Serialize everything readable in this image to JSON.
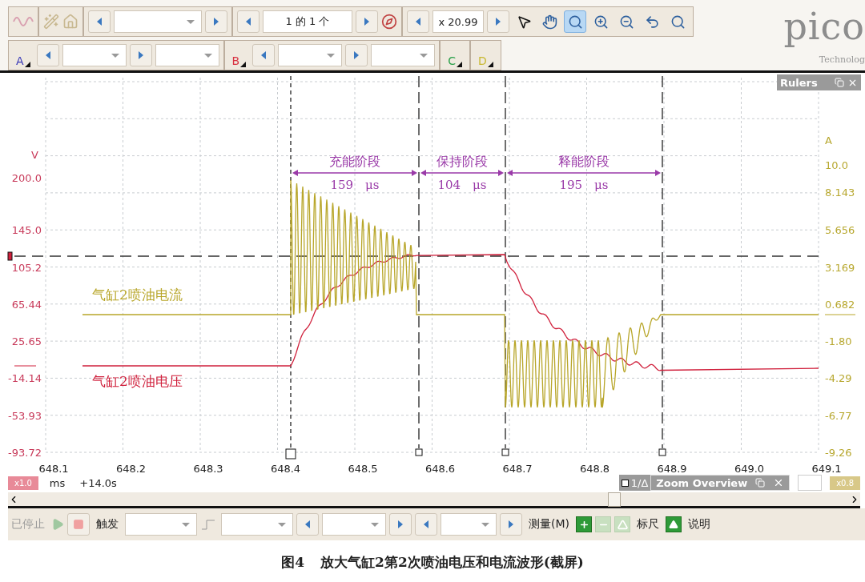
{
  "toolbar_top": {
    "page_field": "1 的 1 个",
    "zoom_field": "x 20.99",
    "tools": [
      {
        "kind": "pointer",
        "selected": false
      },
      {
        "kind": "hand",
        "selected": false
      },
      {
        "kind": "zoom",
        "selected": true
      },
      {
        "kind": "zoom_in",
        "selected": false
      },
      {
        "kind": "zoom_out",
        "selected": false
      },
      {
        "kind": "undo",
        "selected": false
      },
      {
        "kind": "zoom_100",
        "selected": false
      }
    ]
  },
  "channel_bar": {
    "channels": [
      {
        "label": "A",
        "color": "#3a3ab8"
      },
      {
        "label": "B",
        "color": "#d83040"
      },
      {
        "label": "C",
        "color": "#28a048"
      },
      {
        "label": "D",
        "color": "#c8b830"
      }
    ]
  },
  "logo": {
    "text": "pico",
    "subtitle": "Technolog"
  },
  "rulers_panel": {
    "title": "Rulers"
  },
  "plot": {
    "left_axis": {
      "unit": "V",
      "ticks": [
        "200.0",
        "145.0",
        "105.2",
        "65.44",
        "25.65",
        "-14.14",
        "-53.93",
        "-93.72"
      ]
    },
    "right_axis": {
      "unit": "A",
      "ticks": [
        "10.0",
        "8.143",
        "5.656",
        "3.169",
        "0.682",
        "-1.80",
        "-4.29",
        "-6.77",
        "-9.26"
      ]
    },
    "x_ticks": [
      "648.1",
      "648.2",
      "648.3",
      "648.4",
      "648.5",
      "648.6",
      "648.7",
      "648.8",
      "648.9",
      "649.0",
      "649.1"
    ],
    "phases": [
      {
        "name": "充能阶段",
        "duration": "159　μs"
      },
      {
        "name": "保持阶段",
        "duration": "104　μs"
      },
      {
        "name": "释能阶段",
        "duration": "195　μs"
      }
    ],
    "traces": [
      {
        "name": "气缸2喷油电流",
        "color": "#b8a62a"
      },
      {
        "name": "气缸2喷油电压",
        "color": "#d0203c"
      }
    ]
  },
  "status": {
    "scale_badge": "x1.0",
    "unit": "ms",
    "offset": "+14.0s",
    "zoom_overview": {
      "prefix": "1/Δ",
      "title": "Zoom Overview"
    },
    "right_badge": "x0.8"
  },
  "bottom_toolbar": {
    "status": "已停止",
    "trigger_label": "触发",
    "measure_label": "测量(M)",
    "measure_buttons": [
      {
        "kind": "add",
        "disabled": false
      },
      {
        "kind": "remove",
        "disabled": true
      },
      {
        "kind": "edit",
        "disabled": true
      }
    ],
    "ruler_label": "标尺",
    "notes_label": "说明"
  },
  "caption": {
    "label": "图4",
    "text": "放大气缸2第2次喷油电压和电流波形(截屏)"
  }
}
